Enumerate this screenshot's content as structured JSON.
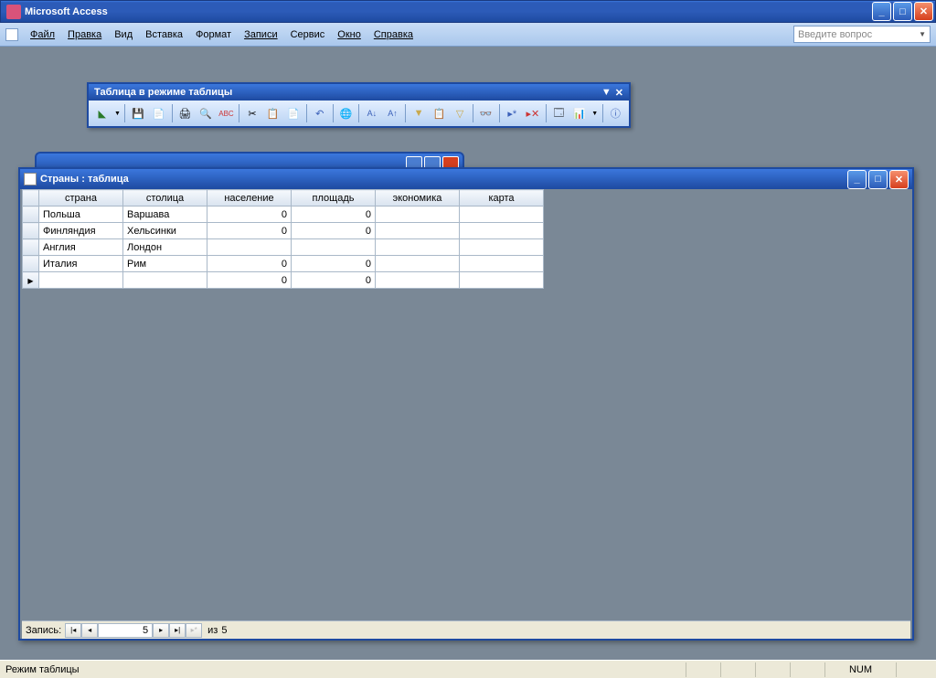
{
  "app_title": "Microsoft Access",
  "menus": {
    "file": "Файл",
    "edit": "Правка",
    "view": "Вид",
    "insert": "Вставка",
    "format": "Формат",
    "records": "Записи",
    "service": "Сервис",
    "window": "Окно",
    "help": "Справка"
  },
  "help_placeholder": "Введите вопрос",
  "toolbox_title": "Таблица в режиме таблицы",
  "datasheet_title": "Страны : таблица",
  "columns": [
    "страна",
    "столица",
    "население",
    "площадь",
    "экономика",
    "карта"
  ],
  "rows": [
    {
      "country": "Польша",
      "capital": "Варшава",
      "pop": "0",
      "area": "0",
      "econ": "",
      "map": ""
    },
    {
      "country": "Финляндия",
      "capital": "Хельсинки",
      "pop": "0",
      "area": "0",
      "econ": "",
      "map": ""
    },
    {
      "country": "Англия",
      "capital": "Лондон",
      "pop": "",
      "area": "",
      "econ": "",
      "map": ""
    },
    {
      "country": "Италия",
      "capital": "Рим",
      "pop": "0",
      "area": "0",
      "econ": "",
      "map": ""
    }
  ],
  "new_row": {
    "pop": "0",
    "area": "0"
  },
  "recnav": {
    "label": "Запись:",
    "current": "5",
    "of_label": "из",
    "total": "5"
  },
  "status": {
    "mode": "Режим таблицы",
    "num": "NUM"
  }
}
